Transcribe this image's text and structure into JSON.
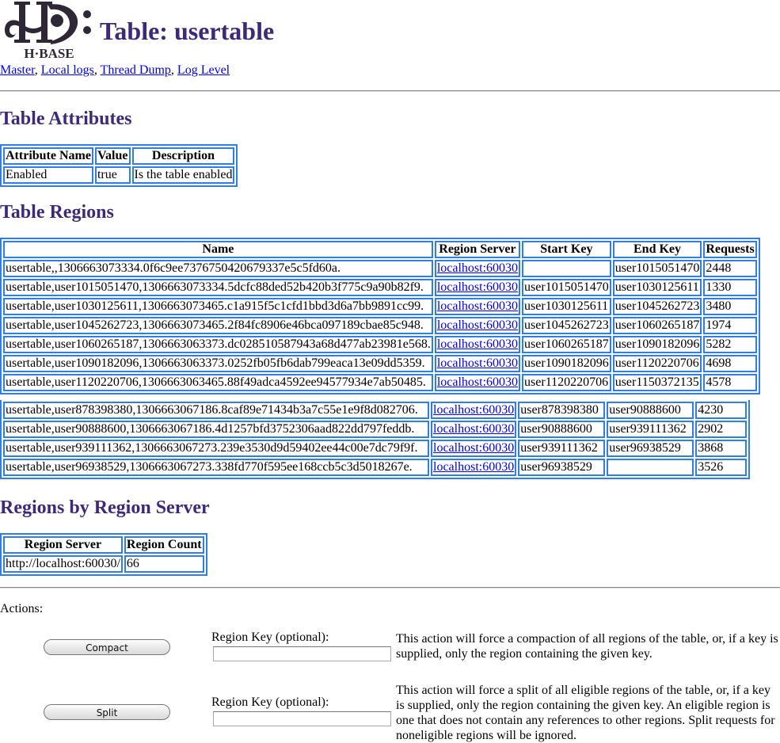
{
  "header": {
    "logo_text": "H·BASE",
    "title": "Table: usertable"
  },
  "nav": {
    "links": [
      "Master",
      "Local logs",
      "Thread Dump",
      "Log Level"
    ],
    "separator": ", "
  },
  "attributes": {
    "heading": "Table Attributes",
    "columns": [
      "Attribute Name",
      "Value",
      "Description"
    ],
    "rows": [
      [
        "Enabled",
        "true",
        "Is the table enabled"
      ]
    ]
  },
  "regions": {
    "heading": "Table Regions",
    "columns": [
      "Name",
      "Region Server",
      "Start Key",
      "End Key",
      "Requests"
    ],
    "rows_top": [
      {
        "name": "usertable,,1306663073334.0f6c9ee7376750420679337e5c5fd60a.",
        "server": "localhost:60030",
        "start": "",
        "end": "user1015051470",
        "requests": "2448"
      },
      {
        "name": "usertable,user1015051470,1306663073334.5dcfc88ded52b420b3f775c9a90b82f9.",
        "server": "localhost:60030",
        "start": "user1015051470",
        "end": "user1030125611",
        "requests": "1330"
      },
      {
        "name": "usertable,user1030125611,1306663073465.c1a915f5c1cfd1bbd3d6a7bb9891cc99.",
        "server": "localhost:60030",
        "start": "user1030125611",
        "end": "user1045262723",
        "requests": "3480"
      },
      {
        "name": "usertable,user1045262723,1306663073465.2f84fc8906e46bca097189cbae85c948.",
        "server": "localhost:60030",
        "start": "user1045262723",
        "end": "user1060265187",
        "requests": "1974"
      },
      {
        "name": "usertable,user1060265187,1306663063373.dc028510587943a68d477ab23981e568.",
        "server": "localhost:60030",
        "start": "user1060265187",
        "end": "user1090182096",
        "requests": "5282"
      },
      {
        "name": "usertable,user1090182096,1306663063373.0252fb05fb6dab799eaca13e09dd5359.",
        "server": "localhost:60030",
        "start": "user1090182096",
        "end": "user1120220706",
        "requests": "4698"
      },
      {
        "name": "usertable,user1120220706,1306663063465.88f49adca4592ee94577934e7ab50485.",
        "server": "localhost:60030",
        "start": "user1120220706",
        "end": "user1150372135",
        "requests": "4578"
      }
    ],
    "rows_bottom": [
      {
        "name": "usertable,user878398380,1306663067186.8caf89e71434b3a7c55e1e9f8d082706.",
        "server": "localhost:60030",
        "start": "user878398380",
        "end": "user90888600",
        "requests": "4230"
      },
      {
        "name": "usertable,user90888600,1306663067186.4d1257bfd3752306aad822dd797feddb.",
        "server": "localhost:60030",
        "start": "user90888600",
        "end": "user939111362",
        "requests": "2902"
      },
      {
        "name": "usertable,user939111362,1306663067273.239e3530d9d59402ee44c00e7dc79f9f.",
        "server": "localhost:60030",
        "start": "user939111362",
        "end": "user96938529",
        "requests": "3868"
      },
      {
        "name": "usertable,user96938529,1306663067273.338fd770f595ee168ccb5c3d5018267e.",
        "server": "localhost:60030",
        "start": "user96938529",
        "end": "",
        "requests": "3526"
      }
    ]
  },
  "servers": {
    "heading": "Regions by Region Server",
    "columns": [
      "Region Server",
      "Region Count"
    ],
    "rows": [
      [
        "http://localhost:60030/",
        "66"
      ]
    ]
  },
  "actions": {
    "label": "Actions:",
    "compact": {
      "button": "Compact",
      "key_label": "Region Key (optional):",
      "key_value": "",
      "description": "This action will force a compaction of all regions of the table, or, if a key is supplied, only the region containing the given key."
    },
    "split": {
      "button": "Split",
      "key_label": "Region Key (optional):",
      "key_value": "",
      "description": "This action will force a split of all eligible regions of the table, or, if a key is supplied, only the region containing the given key. An eligible region is one that does not contain any references to other regions. Split requests for noneligible regions will be ignored."
    }
  },
  "colors": {
    "heading": "#3c2a78",
    "table_border": "#2f7ee3",
    "link": "#0000ee"
  }
}
